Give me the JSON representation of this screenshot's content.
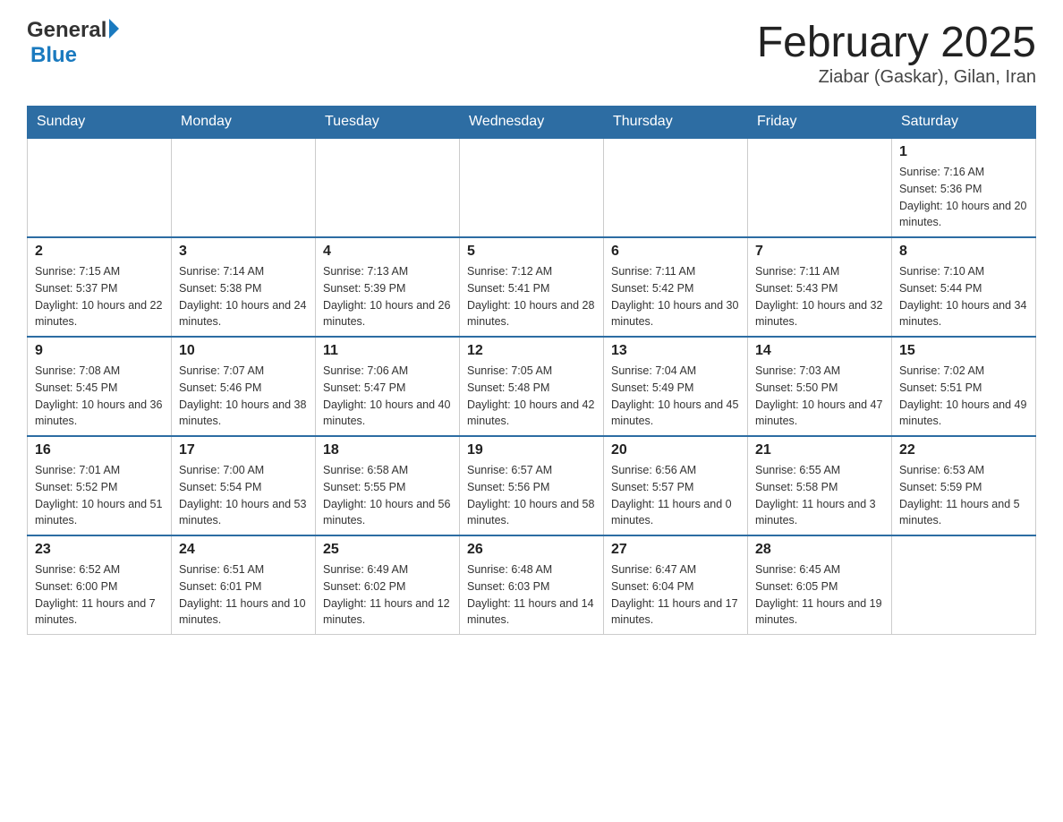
{
  "header": {
    "logo_general": "General",
    "logo_blue": "Blue",
    "month_title": "February 2025",
    "location": "Ziabar (Gaskar), Gilan, Iran"
  },
  "days_of_week": [
    "Sunday",
    "Monday",
    "Tuesday",
    "Wednesday",
    "Thursday",
    "Friday",
    "Saturday"
  ],
  "weeks": [
    [
      null,
      null,
      null,
      null,
      null,
      null,
      {
        "day": 1,
        "sunrise": "7:16 AM",
        "sunset": "5:36 PM",
        "daylight": "10 hours and 20 minutes."
      }
    ],
    [
      {
        "day": 2,
        "sunrise": "7:15 AM",
        "sunset": "5:37 PM",
        "daylight": "10 hours and 22 minutes."
      },
      {
        "day": 3,
        "sunrise": "7:14 AM",
        "sunset": "5:38 PM",
        "daylight": "10 hours and 24 minutes."
      },
      {
        "day": 4,
        "sunrise": "7:13 AM",
        "sunset": "5:39 PM",
        "daylight": "10 hours and 26 minutes."
      },
      {
        "day": 5,
        "sunrise": "7:12 AM",
        "sunset": "5:41 PM",
        "daylight": "10 hours and 28 minutes."
      },
      {
        "day": 6,
        "sunrise": "7:11 AM",
        "sunset": "5:42 PM",
        "daylight": "10 hours and 30 minutes."
      },
      {
        "day": 7,
        "sunrise": "7:11 AM",
        "sunset": "5:43 PM",
        "daylight": "10 hours and 32 minutes."
      },
      {
        "day": 8,
        "sunrise": "7:10 AM",
        "sunset": "5:44 PM",
        "daylight": "10 hours and 34 minutes."
      }
    ],
    [
      {
        "day": 9,
        "sunrise": "7:08 AM",
        "sunset": "5:45 PM",
        "daylight": "10 hours and 36 minutes."
      },
      {
        "day": 10,
        "sunrise": "7:07 AM",
        "sunset": "5:46 PM",
        "daylight": "10 hours and 38 minutes."
      },
      {
        "day": 11,
        "sunrise": "7:06 AM",
        "sunset": "5:47 PM",
        "daylight": "10 hours and 40 minutes."
      },
      {
        "day": 12,
        "sunrise": "7:05 AM",
        "sunset": "5:48 PM",
        "daylight": "10 hours and 42 minutes."
      },
      {
        "day": 13,
        "sunrise": "7:04 AM",
        "sunset": "5:49 PM",
        "daylight": "10 hours and 45 minutes."
      },
      {
        "day": 14,
        "sunrise": "7:03 AM",
        "sunset": "5:50 PM",
        "daylight": "10 hours and 47 minutes."
      },
      {
        "day": 15,
        "sunrise": "7:02 AM",
        "sunset": "5:51 PM",
        "daylight": "10 hours and 49 minutes."
      }
    ],
    [
      {
        "day": 16,
        "sunrise": "7:01 AM",
        "sunset": "5:52 PM",
        "daylight": "10 hours and 51 minutes."
      },
      {
        "day": 17,
        "sunrise": "7:00 AM",
        "sunset": "5:54 PM",
        "daylight": "10 hours and 53 minutes."
      },
      {
        "day": 18,
        "sunrise": "6:58 AM",
        "sunset": "5:55 PM",
        "daylight": "10 hours and 56 minutes."
      },
      {
        "day": 19,
        "sunrise": "6:57 AM",
        "sunset": "5:56 PM",
        "daylight": "10 hours and 58 minutes."
      },
      {
        "day": 20,
        "sunrise": "6:56 AM",
        "sunset": "5:57 PM",
        "daylight": "11 hours and 0 minutes."
      },
      {
        "day": 21,
        "sunrise": "6:55 AM",
        "sunset": "5:58 PM",
        "daylight": "11 hours and 3 minutes."
      },
      {
        "day": 22,
        "sunrise": "6:53 AM",
        "sunset": "5:59 PM",
        "daylight": "11 hours and 5 minutes."
      }
    ],
    [
      {
        "day": 23,
        "sunrise": "6:52 AM",
        "sunset": "6:00 PM",
        "daylight": "11 hours and 7 minutes."
      },
      {
        "day": 24,
        "sunrise": "6:51 AM",
        "sunset": "6:01 PM",
        "daylight": "11 hours and 10 minutes."
      },
      {
        "day": 25,
        "sunrise": "6:49 AM",
        "sunset": "6:02 PM",
        "daylight": "11 hours and 12 minutes."
      },
      {
        "day": 26,
        "sunrise": "6:48 AM",
        "sunset": "6:03 PM",
        "daylight": "11 hours and 14 minutes."
      },
      {
        "day": 27,
        "sunrise": "6:47 AM",
        "sunset": "6:04 PM",
        "daylight": "11 hours and 17 minutes."
      },
      {
        "day": 28,
        "sunrise": "6:45 AM",
        "sunset": "6:05 PM",
        "daylight": "11 hours and 19 minutes."
      },
      null
    ]
  ]
}
